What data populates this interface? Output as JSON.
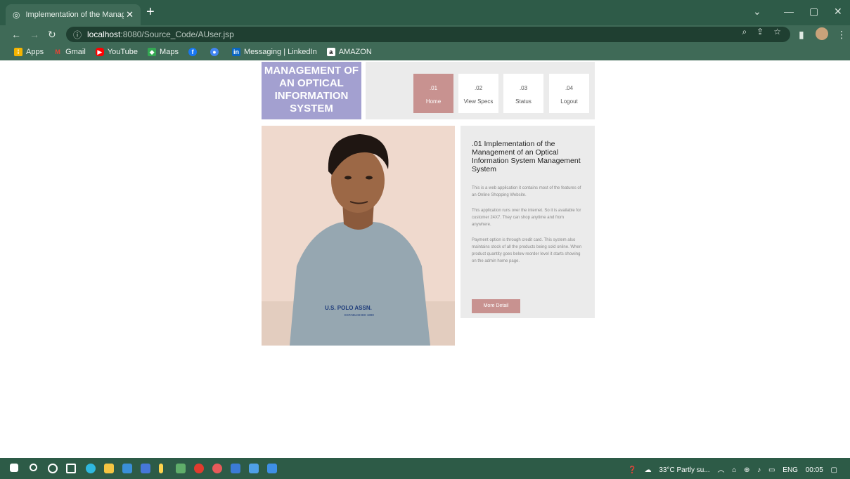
{
  "browser": {
    "tab_title": "Implementation of the Managem",
    "tab_close": "✕",
    "new_tab": "+",
    "url_scheme_icon": "info-icon",
    "url_host": "localhost",
    "url_path": ":8080/Source_Code/AUser.jsp",
    "window_controls": [
      "⌄",
      "—",
      "▢",
      "✕"
    ],
    "bookmarks": [
      {
        "label": "Apps",
        "icon": "apps-grid-icon",
        "color": "#f4b400"
      },
      {
        "label": "Gmail",
        "icon": "gmail-icon",
        "color": "#ea4335"
      },
      {
        "label": "YouTube",
        "icon": "youtube-icon",
        "color": "#ff0000"
      },
      {
        "label": "Maps",
        "icon": "maps-icon",
        "color": "#34a853"
      },
      {
        "label": "",
        "icon": "facebook-icon",
        "color": "#1877f2"
      },
      {
        "label": "",
        "icon": "chrome-extension-icon",
        "color": "#4285f4"
      },
      {
        "label": "Messaging | LinkedIn",
        "icon": "linkedin-icon",
        "color": "#0a66c2"
      },
      {
        "label": "AMAZON",
        "icon": "amazon-icon",
        "color": "#ffffff"
      }
    ]
  },
  "site": {
    "logo_line1": "MANAGEMENT OF",
    "logo_line2": "AN OPTICAL",
    "logo_line3": "INFORMATION",
    "logo_line4": "SYSTEM",
    "nav": [
      {
        "num": ".01",
        "label": "Home",
        "active": true
      },
      {
        "num": ".02",
        "label": "View Specs",
        "active": false
      },
      {
        "num": ".03",
        "label": "Status",
        "active": false
      },
      {
        "num": ".04",
        "label": "Logout",
        "active": false
      }
    ],
    "shirt_text1": "U.S. POLO ASSN.",
    "shirt_text2": "ESTABLISHED 1890",
    "card": {
      "title": ".01 Implementation of the Management of an Optical Information System Management System",
      "p1": "This is a web application it contains most of the features of an Online Shopping Website.",
      "p2": "This application runs over the internet. So it is available for customer 24X7. They can shop anytime and from anywhere.",
      "p3": "Payment option is through credit card. This system also maintains stock of all the products being sold online. When product quantity goes below reorder level it starts showing on the admin home page.",
      "button": "More Detail"
    }
  },
  "taskbar": {
    "weather": "33°C Partly su...",
    "lang": "ENG",
    "time": "00:05"
  },
  "colors": {
    "chrome_dark": "#2e5b48",
    "chrome_mid": "#3f6a57",
    "logo_bg": "#a3a0d0",
    "accent": "#c89290",
    "panel_bg": "#ebebeb"
  }
}
